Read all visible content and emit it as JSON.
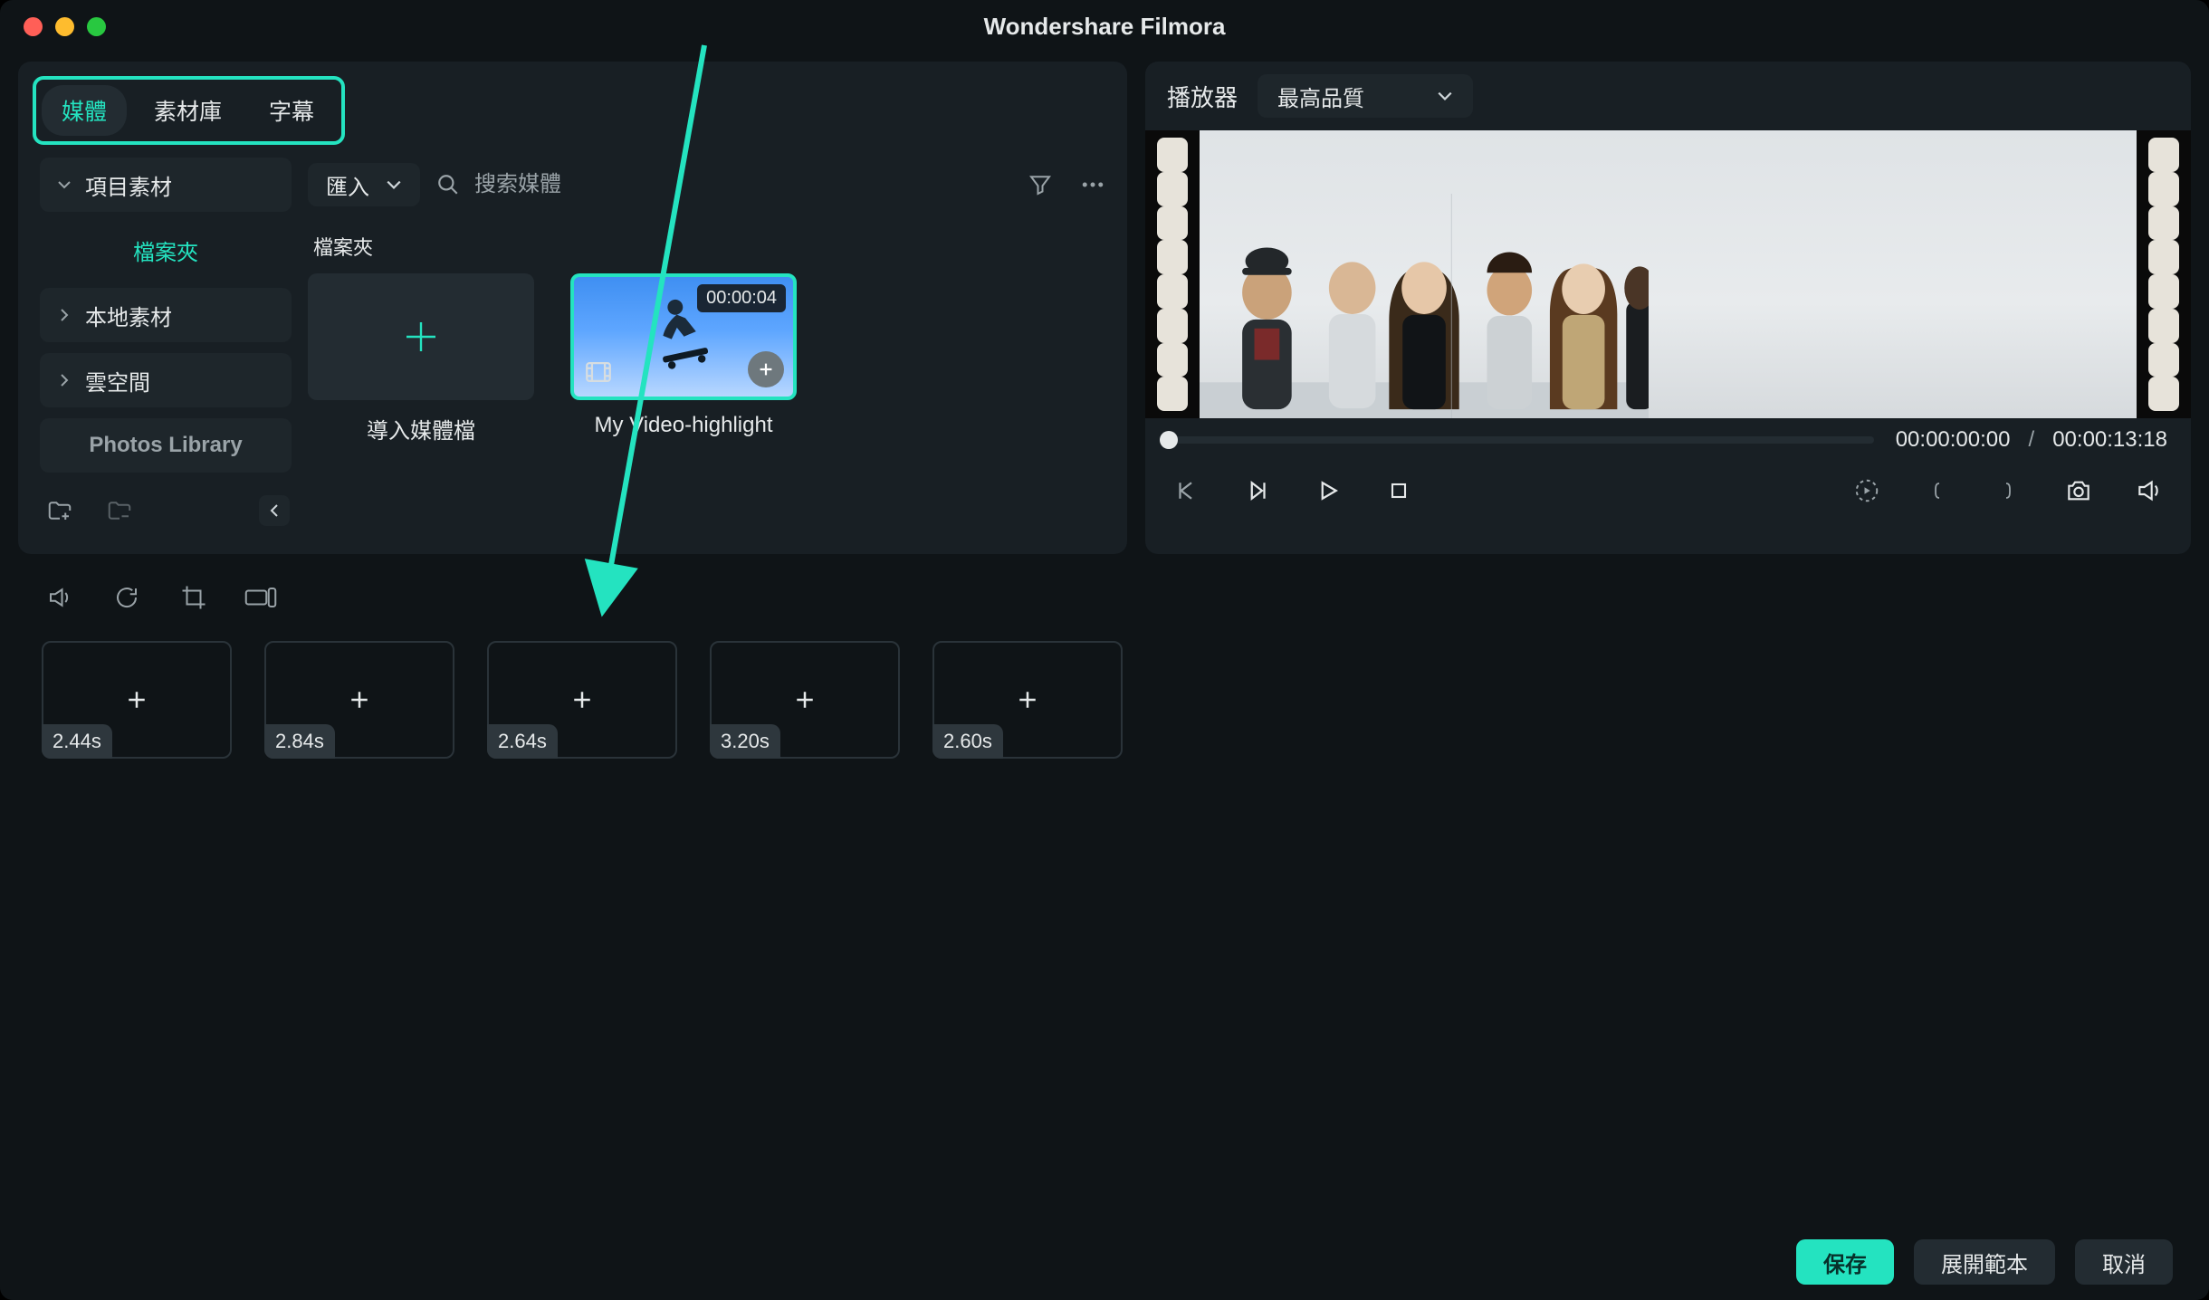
{
  "app_title": "Wondershare Filmora",
  "tabs": {
    "media": "媒體",
    "library": "素材庫",
    "subtitles": "字幕"
  },
  "sidebar": {
    "project": "項目素材",
    "folder": "檔案夾",
    "local": "本地素材",
    "cloud": "雲空間",
    "photos": "Photos Library"
  },
  "toolbar": {
    "import": "匯入",
    "search_placeholder": "搜索媒體"
  },
  "content": {
    "section_label": "檔案夾",
    "import_card": "導入媒體檔",
    "clip_name": "My Video-highlight",
    "clip_duration": "00:00:04"
  },
  "player": {
    "label": "播放器",
    "quality": "最高品質",
    "position": "00:00:00:00",
    "separator": "/",
    "duration": "00:00:13:18"
  },
  "timeline": {
    "slots": [
      "2.44s",
      "2.84s",
      "2.64s",
      "3.20s",
      "2.60s"
    ]
  },
  "footer": {
    "save": "保存",
    "template": "展開範本",
    "cancel": "取消"
  }
}
